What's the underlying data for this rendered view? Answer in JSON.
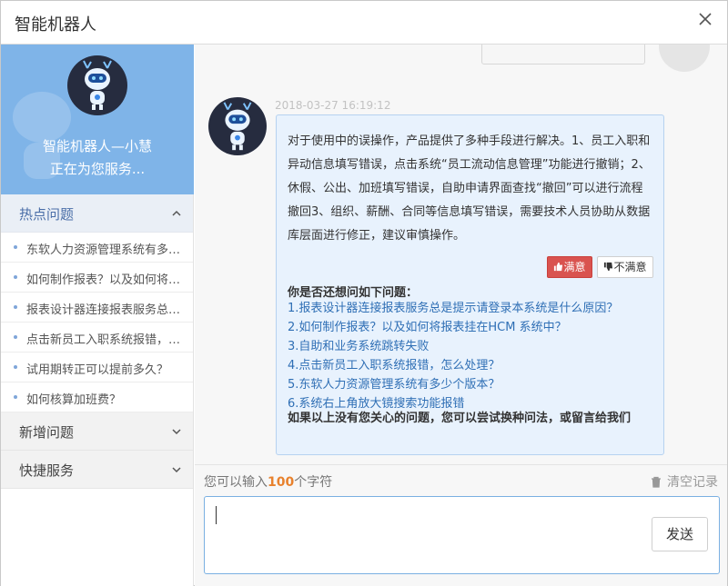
{
  "window": {
    "title": "智能机器人"
  },
  "profile": {
    "name": "智能机器人—小慧",
    "status": "正在为您服务..."
  },
  "sidebar": {
    "hot_label": "热点问题",
    "hot_items": [
      "东软人力资源管理系统有多少个版本？",
      "如何制作报表？以及如何将报表挂在HCM 系统中？",
      "报表设计器连接报表服务总是提示请登录本系统是什么原因？",
      "点击新员工入职系统报错，怎么处理？",
      "试用期转正可以提前多久？",
      "如何核算加班费？"
    ],
    "new_label": "新增问题",
    "quick_label": "快捷服务"
  },
  "chat": {
    "timestamp": "2018-03-27 16:19:12",
    "answer": "对于使用中的误操作，产品提供了多种手段进行解决。1、员工入职和异动信息填写错误，点击系统“员工流动信息管理”功能进行撤销；2、休假、公出、加班填写错误，自助申请界面查找“撤回”可以进行流程撤回3、组织、薪酬、合同等信息填写错误，需要技术人员协助从数据库层面进行修正，建议审慎操作。",
    "satisfied": "满意",
    "unsatisfied": "不满意",
    "suggest_title": "你是否还想问如下问题：",
    "suggestions": [
      "1.报表设计器连接报表服务总是提示请登录本系统是什么原因？",
      "2.如何制作报表？以及如何将报表挂在HCM 系统中？",
      "3.自助和业务系统跳转失败",
      "4.点击新员工入职系统报错，怎么处理？",
      "5.东软人力资源管理系统有多少个版本？",
      "6.系统右上角放大镜搜索功能报错"
    ],
    "footer": "如果以上没有您关心的问题，您可以尝试换种问法，或留言给我们"
  },
  "input": {
    "limit_prefix": "您可以输入",
    "limit_num": "100",
    "limit_suffix": "个字符",
    "clear": "清空记录",
    "value": "",
    "send": "发送"
  },
  "colors": {
    "sidebar_profile": "#7fb4e8",
    "bubble_bg": "#e8f2fd",
    "bubble_border": "#b6d2f0",
    "satisfied_btn": "#d9534f",
    "link": "#2f6fb5",
    "accent_num": "#e8812d"
  },
  "icons": [
    "close-icon",
    "chevron-up-icon",
    "chevron-down-icon",
    "thumbs-up-icon",
    "thumbs-down-icon",
    "trash-icon",
    "robot-avatar"
  ]
}
